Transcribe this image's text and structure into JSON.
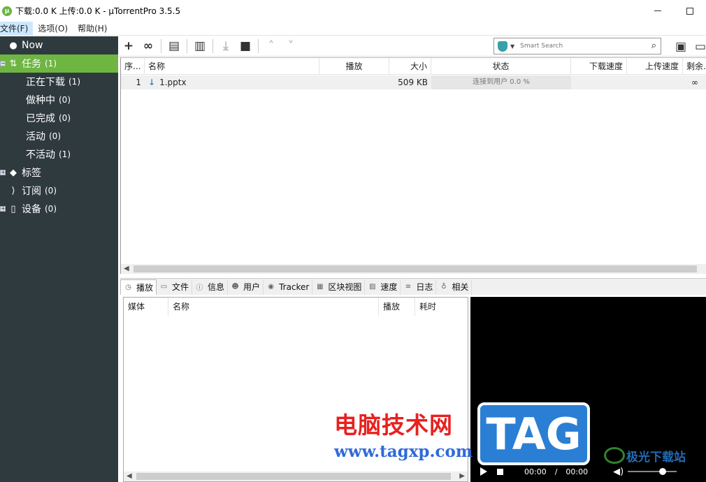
{
  "window": {
    "title": "下载:0.0 K 上传:0.0 K - µTorrentPro 3.5.5",
    "logo_glyph": "µ"
  },
  "menu": [
    "文件(F)",
    "选项(O)",
    "帮助(H)"
  ],
  "sidebar": {
    "items": [
      {
        "label": "Now",
        "count": ""
      },
      {
        "label": "任务",
        "count": "(1)"
      },
      {
        "label": "正在下载",
        "count": "(1)"
      },
      {
        "label": "做种中",
        "count": "(0)"
      },
      {
        "label": "已完成",
        "count": "(0)"
      },
      {
        "label": "活动",
        "count": "(0)"
      },
      {
        "label": "不活动",
        "count": "(1)"
      },
      {
        "label": "标签",
        "count": ""
      },
      {
        "label": "订阅",
        "count": "(0)"
      },
      {
        "label": "设备",
        "count": "(0)"
      }
    ]
  },
  "toolbar": {
    "search_placeholder": "Smart Search"
  },
  "torrent_table": {
    "columns": [
      "序...",
      "名称",
      "播放",
      "大小",
      "状态",
      "下载速度",
      "上传速度",
      "剩余..."
    ],
    "rows": [
      {
        "index": "1",
        "name": "1.pptx",
        "play": "",
        "size": "509 KB",
        "status": "连接到用户 0.0 %",
        "down_speed": "",
        "up_speed": "",
        "remaining": "∞"
      }
    ]
  },
  "tabs": [
    "播放",
    "文件",
    "信息",
    "用户",
    "Tracker",
    "区块视图",
    "速度",
    "日志",
    "相关"
  ],
  "media_table": {
    "columns": [
      "媒体",
      "名称",
      "播放",
      "耗时"
    ]
  },
  "player": {
    "current_time": "00:00",
    "separator": "/",
    "total_time": "00:00",
    "volume_level": 0.7
  },
  "watermark": {
    "cn_text": "电脑技术网",
    "url": "www.tagxp.com",
    "tag": "TAG",
    "site": "极光下载站"
  },
  "colors": {
    "sidebar_bg": "#2f3a3f",
    "sidebar_selected": "#6fb542",
    "download_arrow": "#2f8bd0"
  }
}
